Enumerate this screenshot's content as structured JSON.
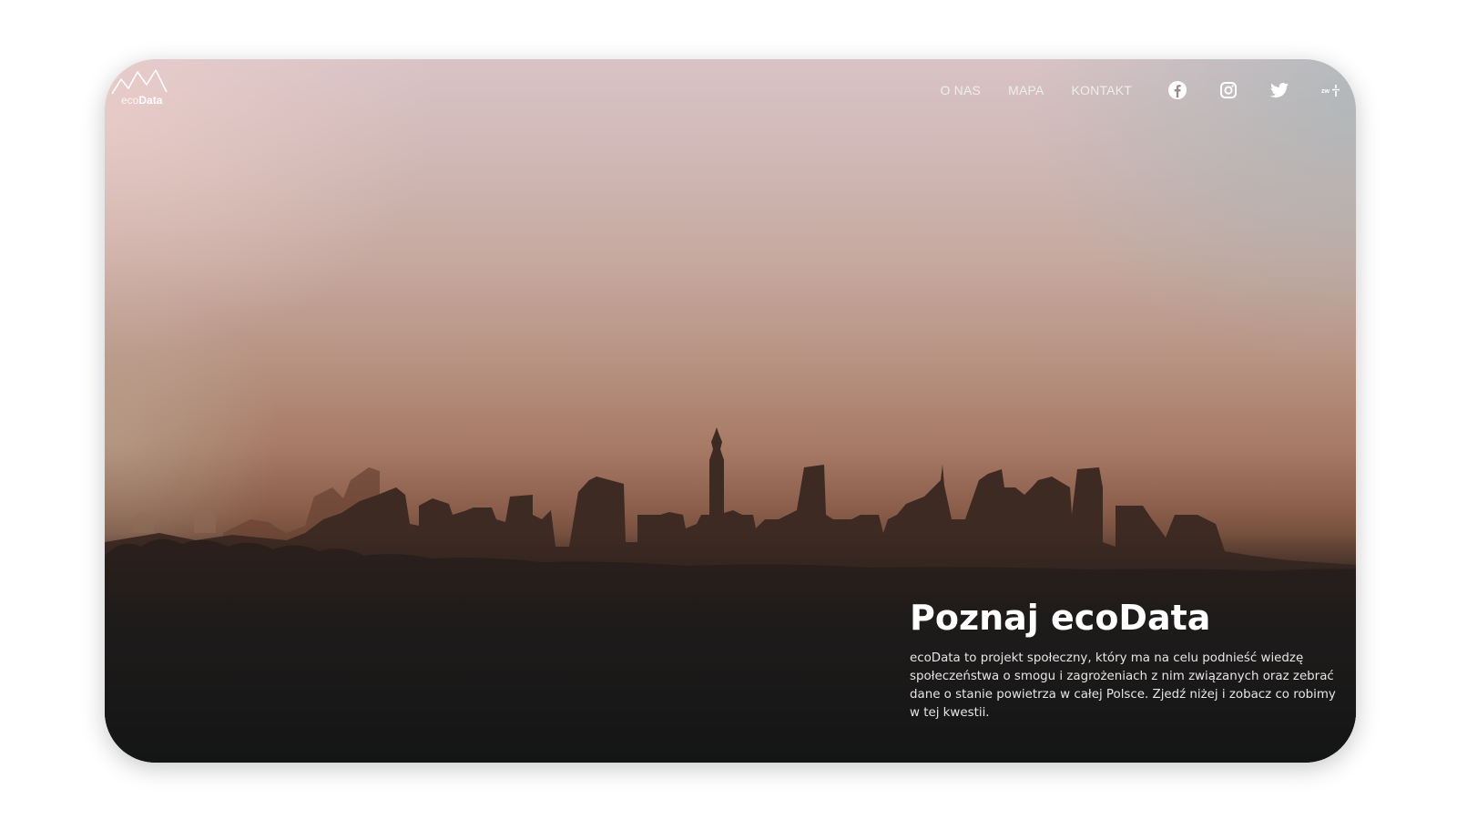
{
  "brand": {
    "logo_light": "eco",
    "logo_bold": "Data",
    "logo_icon": "mountain-peaks-icon"
  },
  "nav": {
    "links": [
      "O NAS",
      "MAPA",
      "KONTAKT"
    ],
    "icons": [
      "facebook-icon",
      "instagram-icon",
      "twitter-icon",
      "zw-settings-icon"
    ]
  },
  "hero": {
    "title": "Poznaj ecoData",
    "text": "ecoData to projekt społeczny, który ma na celu podnieść wiedzę społeczeństwa o smogu i zagrożeniach z nim związanych oraz zebrać dane o stanie powietrza w całej Polsce. Zjedź niżej i zobacz co robimy w tej kwestii."
  },
  "colors": {
    "text": "#ffffff",
    "sky_top": "#d9c3c6",
    "sky_haze": "#b99484",
    "ground": "#151616"
  }
}
